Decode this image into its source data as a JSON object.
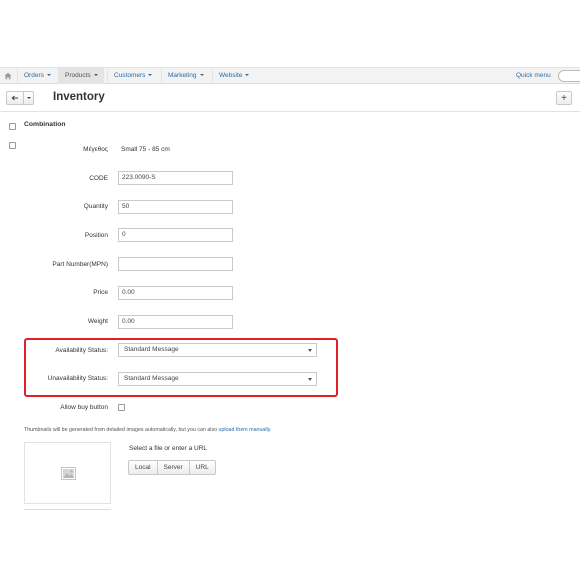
{
  "nav": {
    "items": [
      "Orders",
      "Products",
      "Customers",
      "Marketing",
      "Website"
    ],
    "active_index": 1,
    "quick_menu": "Quick menu"
  },
  "titlebar": {
    "title": "Inventory",
    "add_label": "+"
  },
  "section": {
    "label": "Combination"
  },
  "form": {
    "option_label": "Μέγεθος",
    "option_value": "Small 75 - 85 cm",
    "code_label": "CODE",
    "code_value": "223.0090-S",
    "quantity_label": "Quantity",
    "quantity_value": "50",
    "position_label": "Position",
    "position_value": "0",
    "mpn_label": "Part Number(MPN)",
    "mpn_value": "",
    "price_label": "Price",
    "price_value": "0.00",
    "weight_label": "Weight",
    "weight_value": "0.00",
    "availability_label": "Availability Status:",
    "availability_value": "Standard Message",
    "unavailability_label": "Unavailability Status:",
    "unavailability_value": "Standard Message",
    "allow_buy_label": "Allow buy button"
  },
  "images": {
    "hint_text": "Thumbnails will be generated from detailed images automatically, but you can also",
    "hint_link": "upload them manually.",
    "file_label": "Select a file or enter a URL",
    "sources": [
      "Local",
      "Server",
      "URL"
    ]
  },
  "colors": {
    "link": "#2a6aa8",
    "highlight": "#e0212a"
  }
}
